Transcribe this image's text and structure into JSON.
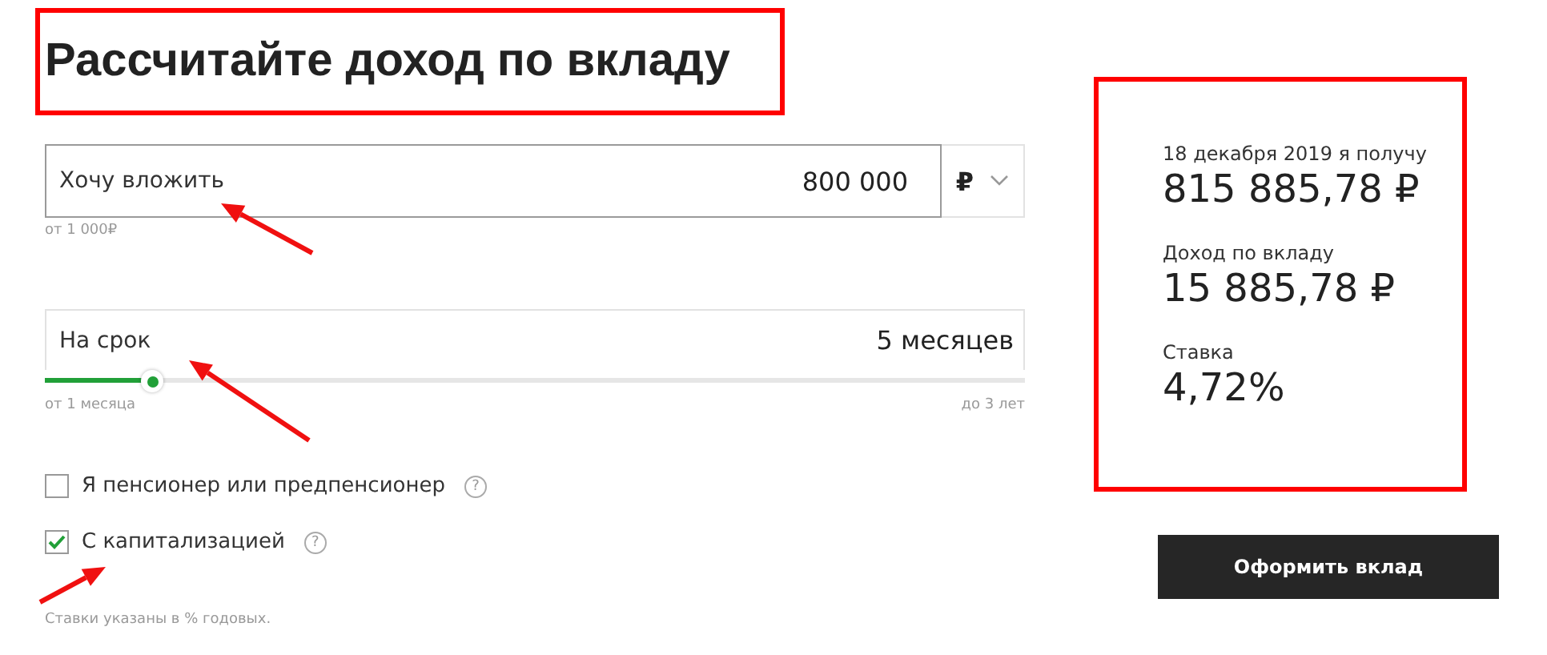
{
  "title": {
    "text": "Рассчитайте доход по вкладу",
    "highlighted": true
  },
  "amount": {
    "label": "Хочу вложить",
    "value": "800 000",
    "currency": "₽",
    "hint": "от 1 000₽",
    "arrow": true
  },
  "term": {
    "label": "На срок",
    "value": "5 месяцев",
    "level": 0.11,
    "min_label": "от 1 месяца",
    "max_label": "до 3 лет",
    "arrow": true
  },
  "options": [
    {
      "label": "Я пенсионер или предпенсионер",
      "checked": false,
      "help": "?",
      "arrow": false
    },
    {
      "label": "С капитализацией",
      "checked": true,
      "help": "?",
      "arrow": true
    }
  ],
  "footnote": "Ставки указаны в % годовых.",
  "result": {
    "highlighted": true,
    "items": [
      {
        "label": "18 декабря 2019 я получу",
        "value": "815 885,78 ₽"
      },
      {
        "label": "Доход по вкладу",
        "value": "15 885,78 ₽"
      },
      {
        "label": "Ставка",
        "value": "4,72%"
      }
    ]
  },
  "submit": "Оформить вклад"
}
